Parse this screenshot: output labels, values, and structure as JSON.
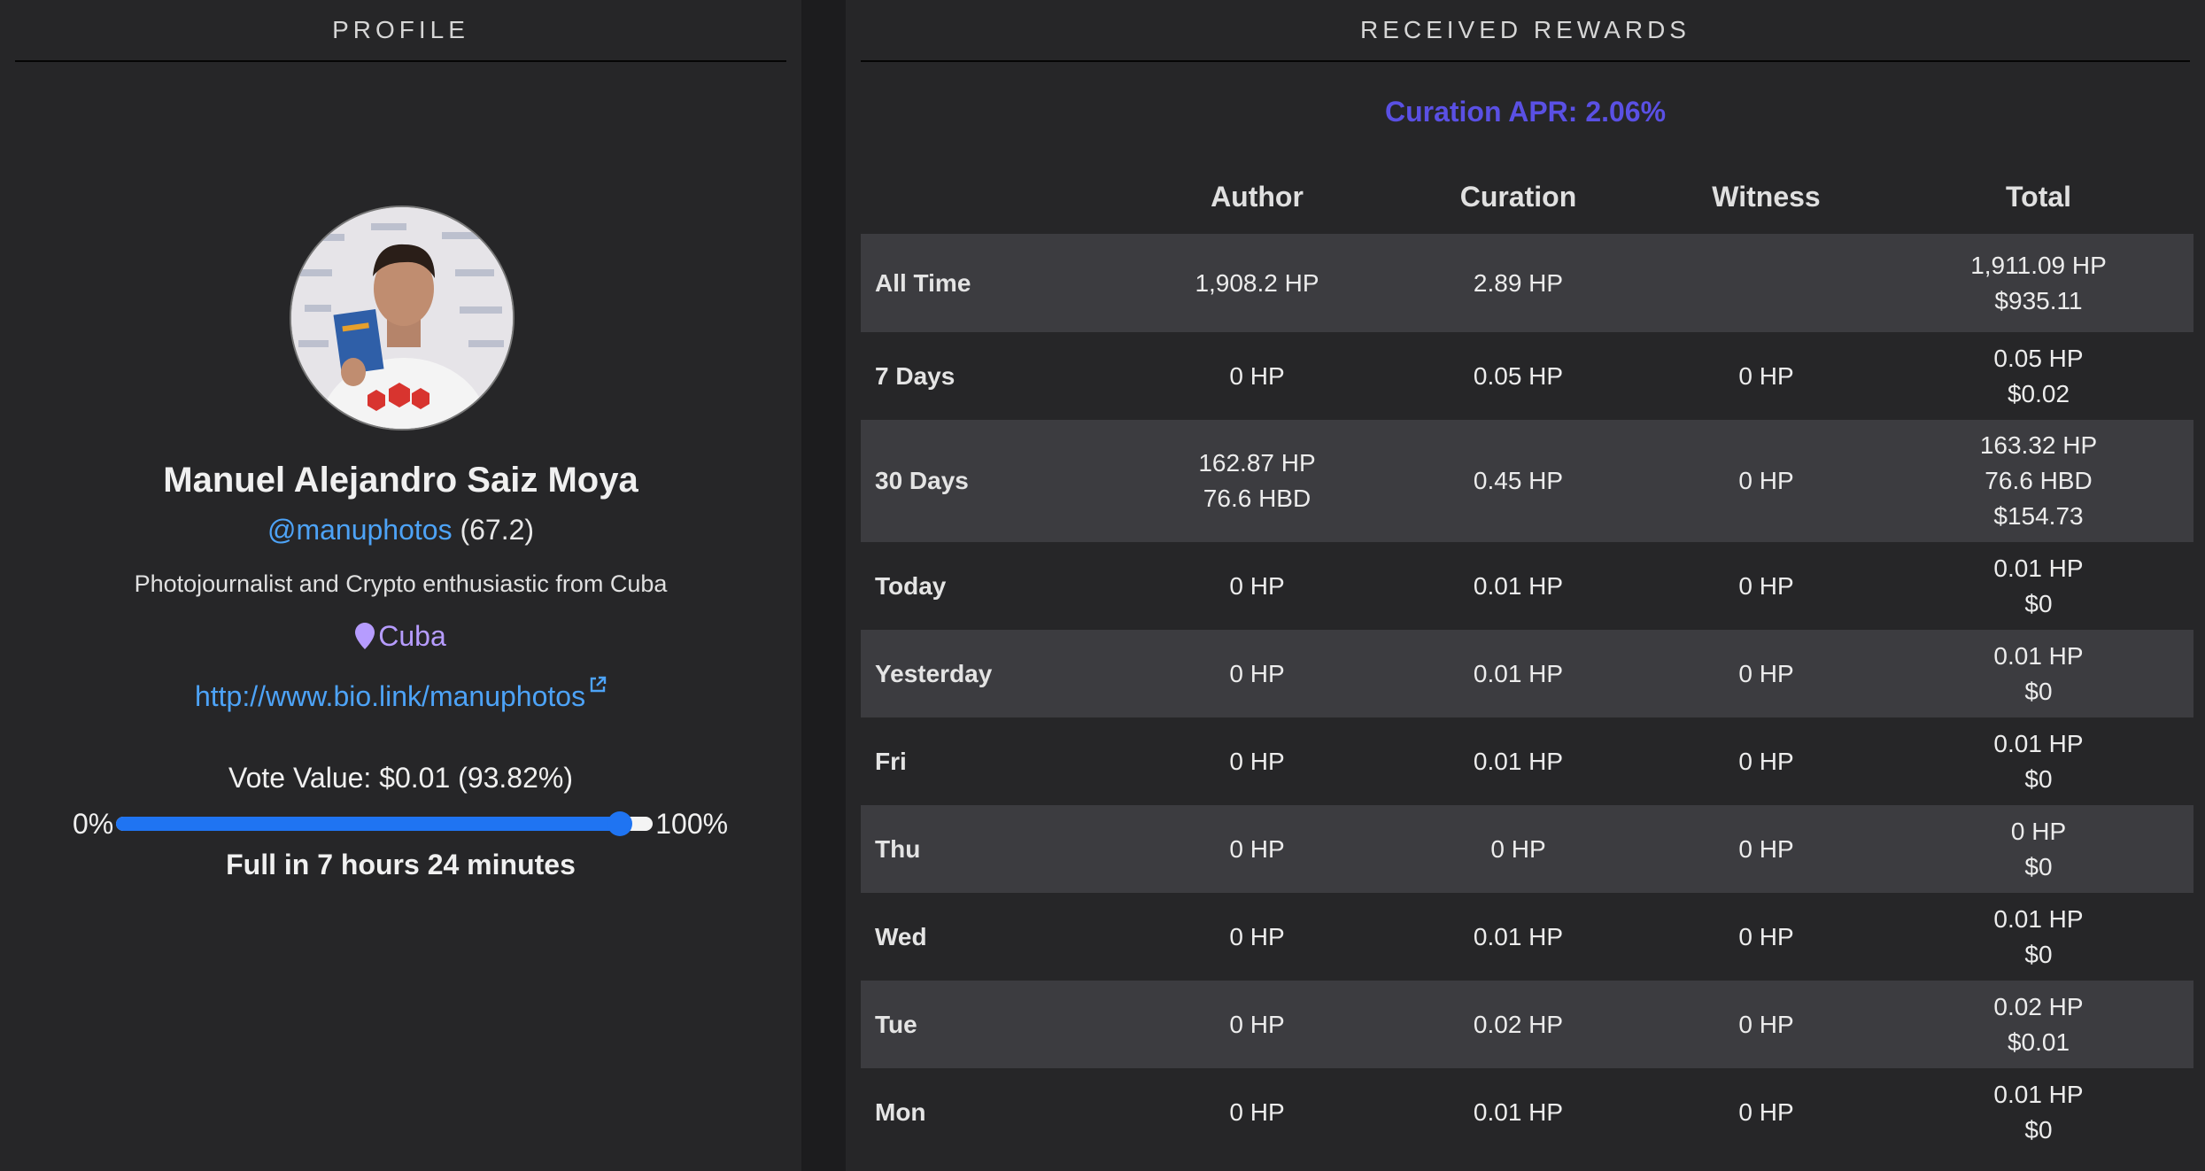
{
  "profile": {
    "header": "PROFILE",
    "display_name": "Manuel Alejandro Saiz Moya",
    "handle": "@manuphotos",
    "reputation": " (67.2)",
    "bio": "Photojournalist and Crypto enthusiastic from Cuba",
    "location": "Cuba",
    "website": "http://www.bio.link/manuphotos",
    "vote_value": "Vote Value: $0.01 (93.82%)",
    "slider_min": "0%",
    "slider_max": "100%",
    "voting_power_fraction": 0.9382,
    "full_in": "Full in 7 hours 24 minutes"
  },
  "rewards": {
    "header": "RECEIVED REWARDS",
    "apr": "Curation APR: 2.06%",
    "columns": [
      "",
      "Author",
      "Curation",
      "Witness",
      "Total"
    ],
    "rows": [
      {
        "label": "All Time",
        "author": [
          "1,908.2 HP"
        ],
        "curation": "2.89 HP",
        "witness": "",
        "total": [
          "1,911.09 HP",
          "$935.11"
        ]
      },
      {
        "label": "7 Days",
        "author": [
          "0 HP"
        ],
        "curation": "0.05 HP",
        "witness": "0 HP",
        "total": [
          "0.05 HP",
          "$0.02"
        ]
      },
      {
        "label": "30 Days",
        "author": [
          "162.87 HP",
          "76.6 HBD"
        ],
        "curation": "0.45 HP",
        "witness": "0 HP",
        "total": [
          "163.32 HP",
          "76.6 HBD",
          "$154.73"
        ]
      },
      {
        "label": "Today",
        "author": [
          "0 HP"
        ],
        "curation": "0.01 HP",
        "witness": "0 HP",
        "total": [
          "0.01 HP",
          "$0"
        ]
      },
      {
        "label": "Yesterday",
        "author": [
          "0 HP"
        ],
        "curation": "0.01 HP",
        "witness": "0 HP",
        "total": [
          "0.01 HP",
          "$0"
        ]
      },
      {
        "label": "Fri",
        "author": [
          "0 HP"
        ],
        "curation": "0.01 HP",
        "witness": "0 HP",
        "total": [
          "0.01 HP",
          "$0"
        ]
      },
      {
        "label": "Thu",
        "author": [
          "0 HP"
        ],
        "curation": "0 HP",
        "witness": "0 HP",
        "total": [
          "0 HP",
          "$0"
        ]
      },
      {
        "label": "Wed",
        "author": [
          "0 HP"
        ],
        "curation": "0.01 HP",
        "witness": "0 HP",
        "total": [
          "0.01 HP",
          "$0"
        ]
      },
      {
        "label": "Tue",
        "author": [
          "0 HP"
        ],
        "curation": "0.02 HP",
        "witness": "0 HP",
        "total": [
          "0.02 HP",
          "$0.01"
        ]
      },
      {
        "label": "Mon",
        "author": [
          "0 HP"
        ],
        "curation": "0.01 HP",
        "witness": "0 HP",
        "total": [
          "0.01 HP",
          "$0"
        ]
      }
    ]
  },
  "colors": {
    "link": "#4da3f7",
    "location": "#b69cff",
    "apr": "#5a50e4",
    "slider": "#1f74f2"
  }
}
